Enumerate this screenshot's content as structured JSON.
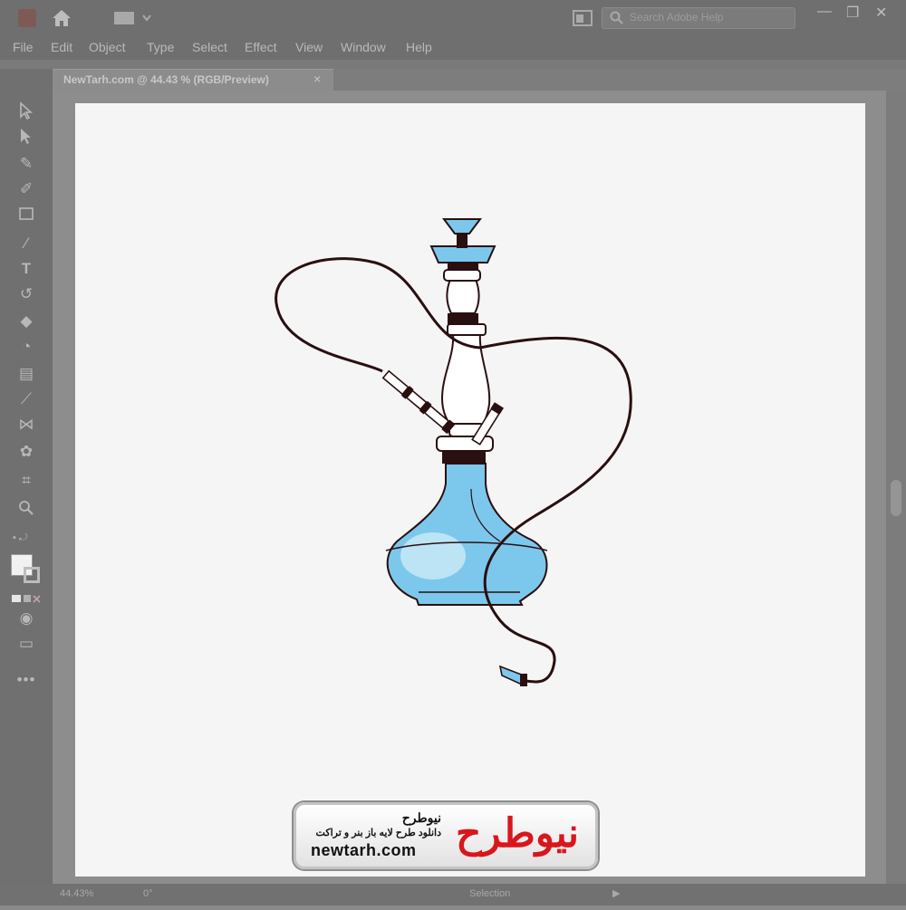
{
  "app": {
    "home_icon": "home-icon",
    "workspace_icon": "workspace-icon",
    "search_placeholder": "Search Adobe Help",
    "menus": [
      "File",
      "Edit",
      "Object",
      "Type",
      "Select",
      "Effect",
      "View",
      "Window",
      "Help"
    ]
  },
  "document": {
    "tab_label": "NewTarh.com @ 44.43 % (RGB/Preview)",
    "close_glyph": "×"
  },
  "status": {
    "zoom": "44.43%",
    "rotation": "0°",
    "tool_name": "Selection"
  },
  "watermark": {
    "title": "نیوطرح",
    "subtitle": "دانلود طرح لایه باز بنر و تراکت",
    "url": "newtarh.com",
    "brand": "نیوطرح"
  },
  "colors": {
    "accent_blue": "#7cc8ec",
    "outline": "#2a0f10",
    "brand_red": "#d9161c"
  }
}
